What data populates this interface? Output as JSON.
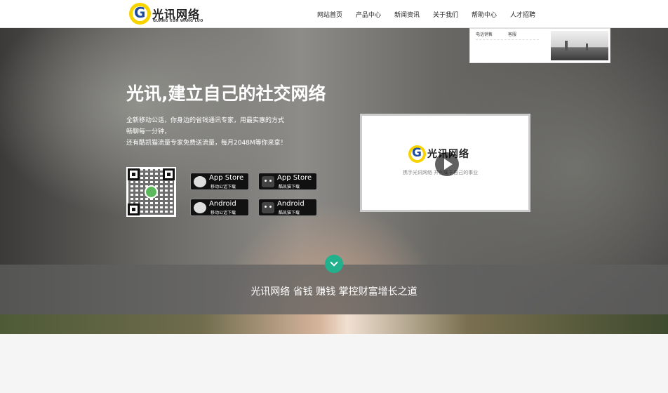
{
  "header": {
    "logo_text": "光讯网络",
    "logo_sub": "GUANG XUN WANG LUO",
    "logo_letter": "G",
    "nav": [
      "网站首页",
      "产品中心",
      "新闻资讯",
      "关于我们",
      "帮助中心",
      "人才招聘"
    ]
  },
  "dropdown": {
    "links": [
      "电话销售",
      "客服"
    ]
  },
  "hero": {
    "title": "光讯,建立自己的社交网络",
    "lines": [
      "全新移动公话，你身边的省钱通讯专家，用最实惠的方式",
      "畅聊每一分钟，",
      "还有酷凯猫流量专家免费送流量，每月2048M等你来拿！"
    ],
    "downloads": [
      {
        "main": "App Store",
        "sub": "移动公话下载",
        "icon": "phone-icon"
      },
      {
        "main": "App Store",
        "sub": "酷凯猫下载",
        "icon": "cat-icon"
      },
      {
        "main": "Android",
        "sub": "移动公话下载",
        "icon": "phone-icon"
      },
      {
        "main": "Android",
        "sub": "酷凯猫下载",
        "icon": "cat-icon"
      }
    ],
    "video": {
      "logo_text": "光讯网络",
      "tagline": "携手光讯网络 开创属于自己的事业"
    },
    "band_text": "光讯网络 省钱 赚钱 掌控财富增长之道"
  },
  "colors": {
    "accent": "#21b28d",
    "logo_yellow": "#f7d400",
    "logo_blue": "#1e4da0"
  }
}
